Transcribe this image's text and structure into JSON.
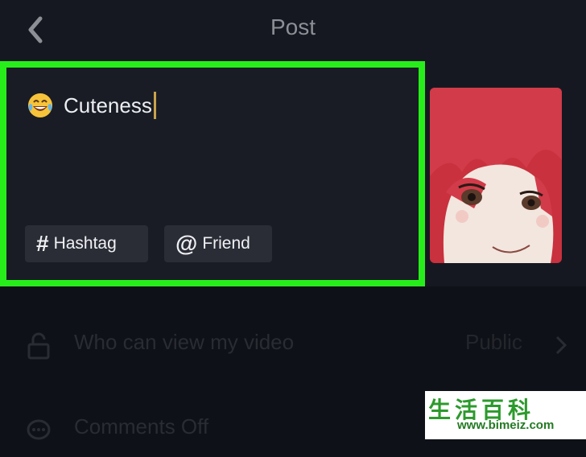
{
  "header": {
    "title": "Post",
    "back_icon": "chevron-left-icon"
  },
  "composer": {
    "caption_text": "Cuteness",
    "caption_emoji": "laughing-tears-emoji",
    "chips": [
      {
        "symbol": "#",
        "label": "Hashtag"
      },
      {
        "symbol": "@",
        "label": "Friend"
      }
    ],
    "highlight_color": "#27ee1b"
  },
  "privacy_row": {
    "label": "Who can view my video",
    "value": "Public",
    "icon": "lock-icon"
  },
  "comments_row": {
    "label": "Comments Off",
    "icon": "comment-icon"
  },
  "watermark": {
    "chars": "生活百科",
    "url": "www.bimeiz.com"
  }
}
